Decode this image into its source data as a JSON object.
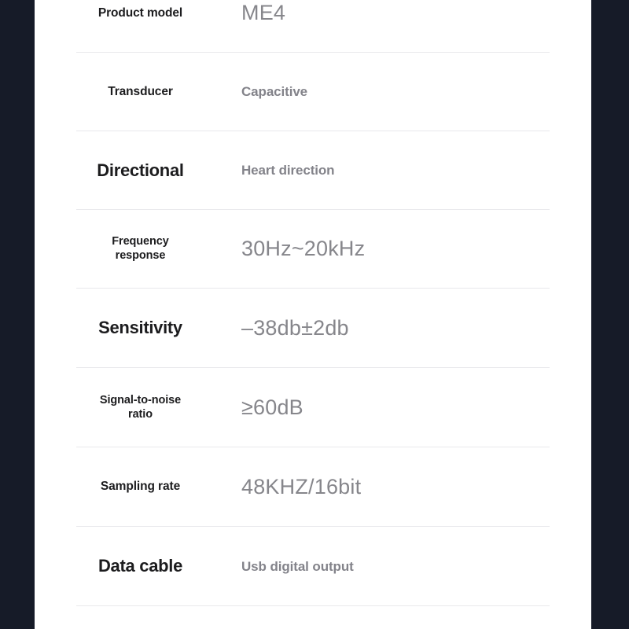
{
  "theme": {
    "bezel_color": "#161b28",
    "sheet_background": "#ffffff",
    "divider_color": "#e9e9ec",
    "label_color": "#1c1c1e",
    "value_color": "#86868b"
  },
  "spec_table": {
    "rows": [
      {
        "label": "Product model",
        "value": "ME4"
      },
      {
        "label": "Transducer",
        "value": "Capacitive"
      },
      {
        "label": "Directional",
        "value": "Heart direction"
      },
      {
        "label": "Frequency\nresponse",
        "label_line1": "Frequency",
        "label_line2": "response",
        "value": "30Hz~20kHz"
      },
      {
        "label": "Sensitivity",
        "value": "–38db±2db"
      },
      {
        "label": "Signal-to-noise\nratio",
        "label_line1": "Signal-to-noise",
        "label_line2": "ratio",
        "value": "≥60dB"
      },
      {
        "label": "Sampling rate",
        "value": "48KHZ/16bit"
      },
      {
        "label": "Data cable",
        "value": "Usb digital output"
      }
    ]
  }
}
